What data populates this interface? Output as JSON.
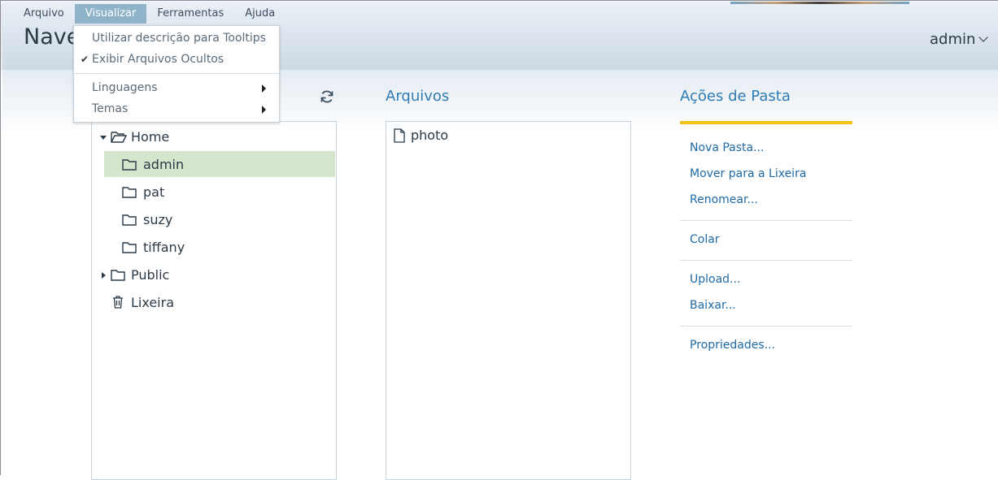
{
  "menubar": {
    "items": [
      "Arquivo",
      "Visualizar",
      "Ferramentas",
      "Ajuda"
    ]
  },
  "app": {
    "title": "Navegador de Arquivos",
    "user": "admin"
  },
  "view_menu": {
    "items": [
      {
        "label": "Utilizar descrição para Tooltips"
      },
      {
        "label": "Exibir Arquivos Ocultos",
        "checked": true
      },
      {
        "label": "Linguagens",
        "submenu": true
      },
      {
        "label": "Temas",
        "submenu": true
      }
    ]
  },
  "tree": {
    "items": [
      {
        "label": "Home",
        "expanded": true
      },
      {
        "label": "admin",
        "selected": true
      },
      {
        "label": "pat"
      },
      {
        "label": "suzy"
      },
      {
        "label": "tiffany"
      },
      {
        "label": "Public",
        "expanded": false
      },
      {
        "label": "Lixeira"
      }
    ]
  },
  "files": {
    "title": "Arquivos",
    "items": [
      {
        "label": "photo"
      }
    ]
  },
  "actions": {
    "title": "Ações de Pasta",
    "items": [
      "Nova Pasta...",
      "Mover para a Lixeira",
      "Renomear...",
      "Colar",
      "Upload...",
      "Baixar...",
      "Propriedades..."
    ]
  },
  "colors": {
    "accent": "#2e7cb3",
    "selection": "#d5e6cd",
    "menu_active": "#8fb4c9",
    "actions_bar": "#f0c419"
  }
}
